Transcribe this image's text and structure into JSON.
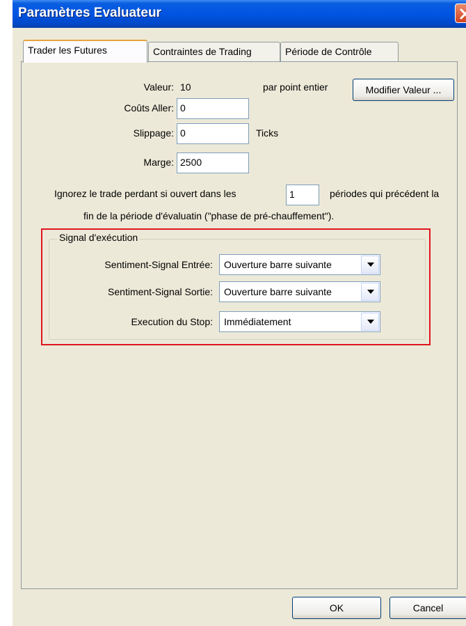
{
  "window": {
    "title": "Paramètres Evaluateur"
  },
  "tabs": [
    {
      "label": "Trader les Futures"
    },
    {
      "label": "Contraintes de Trading"
    },
    {
      "label": "Période de Contrôle"
    }
  ],
  "futures": {
    "valeur_label": "Valeur:",
    "valeur_value": "10",
    "per_point_label": "par point entier",
    "modify_button": "Modifier Valeur ...",
    "couts_label": "Coûts Aller:",
    "couts_value": "0",
    "slippage_label": "Slippage:",
    "slippage_value": "0",
    "ticks_label": "Ticks",
    "marge_label": "Marge:",
    "marge_value": "2500"
  },
  "ignore": {
    "text_before": "Ignorez le trade perdant si ouvert dans les",
    "value": "1",
    "text_after": "périodes qui précédent la",
    "line2": "fin de la période d'évaluatin (\"phase de pré-chauffement\")."
  },
  "signal": {
    "group_title": "Signal d'exécution",
    "entry_label": "Sentiment-Signal Entrée:",
    "entry_value": "Ouverture barre suivante",
    "exit_label": "Sentiment-Signal Sortie:",
    "exit_value": "Ouverture barre suivante",
    "stop_label": "Execution du Stop:",
    "stop_value": "Immédiatement"
  },
  "buttons": {
    "ok": "OK",
    "cancel": "Cancel"
  },
  "colors": {
    "titlebar": "#0054e3",
    "highlight": "#e0141e",
    "dialog_bg": "#ece9d8"
  }
}
